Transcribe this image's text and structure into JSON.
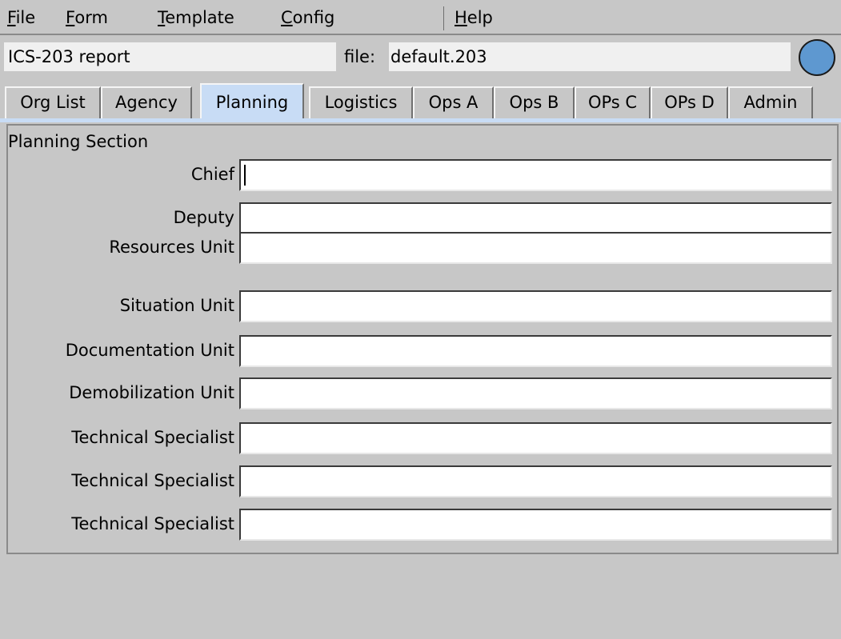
{
  "menu": {
    "file": {
      "u": "F",
      "rest": "ile"
    },
    "form": {
      "u": "F",
      "rest": "orm"
    },
    "template": {
      "u": "T",
      "rest": "emplate"
    },
    "config": {
      "u": "C",
      "rest": "onfig"
    },
    "help": {
      "u": "H",
      "rest": "elp"
    }
  },
  "header": {
    "report_title": "ICS-203 report",
    "file_label": "file:",
    "file_name": "default.203",
    "status_color": "#5e98d0"
  },
  "tabs": [
    {
      "label": "Org List"
    },
    {
      "label": "Agency"
    },
    {
      "label": "Planning",
      "active": true
    },
    {
      "label": "Logistics"
    },
    {
      "label": "Ops A"
    },
    {
      "label": "Ops B"
    },
    {
      "label": "OPs C"
    },
    {
      "label": "OPs D"
    },
    {
      "label": "Admin"
    }
  ],
  "planning": {
    "section_title": "Planning Section",
    "fields": [
      {
        "label": "Chief",
        "value": ""
      },
      {
        "label": "Deputy",
        "value": ""
      },
      {
        "label": "Resources Unit",
        "value": ""
      },
      {
        "label": "Situation Unit",
        "value": ""
      },
      {
        "label": "Documentation Unit",
        "value": ""
      },
      {
        "label": "Demobilization Unit",
        "value": ""
      },
      {
        "label": "Technical Specialist",
        "value": ""
      },
      {
        "label": "Technical Specialist",
        "value": ""
      },
      {
        "label": "Technical Specialist",
        "value": ""
      }
    ]
  },
  "colors": {
    "background": "#c7c7c7",
    "active_tab": "#c8dcf5"
  }
}
